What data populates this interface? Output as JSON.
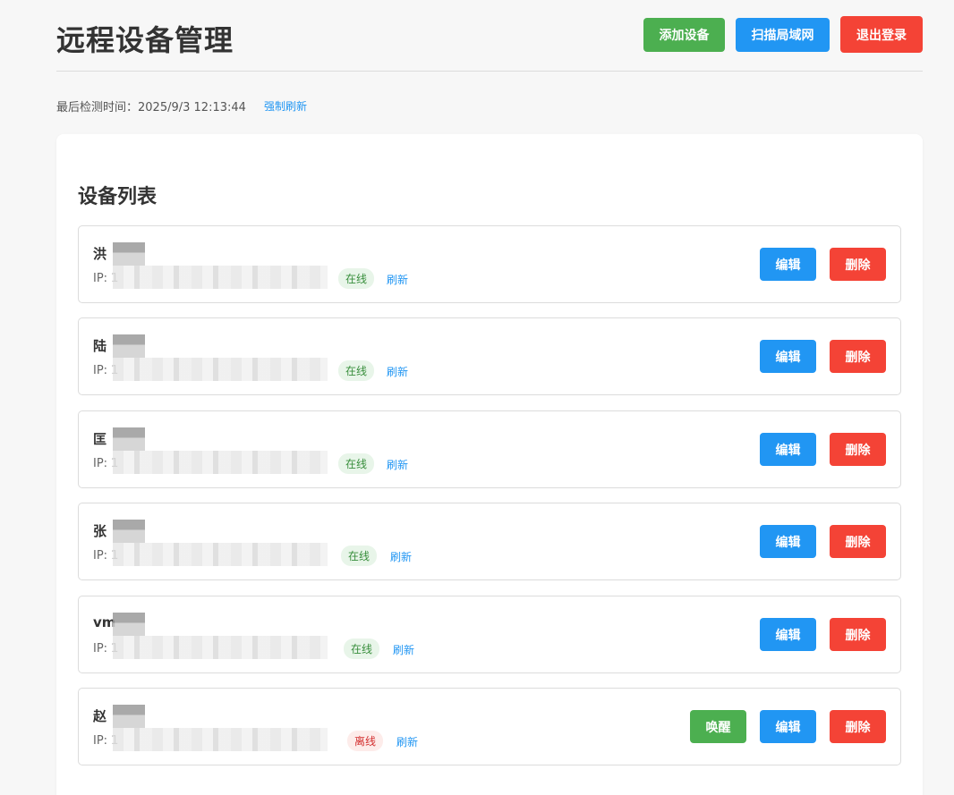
{
  "header": {
    "title": "远程设备管理",
    "add_label": "添加设备",
    "scan_label": "扫描局域网",
    "logout_label": "退出登录"
  },
  "status": {
    "last_check_label": "最后检测时间：",
    "last_check_time": "2025/9/3 12:13:44",
    "force_refresh_label": "强制刷新"
  },
  "device_list": {
    "title": "设备列表",
    "ip_label": "IP: 1",
    "refresh_label": "刷新",
    "edit_label": "编辑",
    "delete_label": "删除",
    "wake_label": "唤醒",
    "devices": [
      {
        "name": "洪",
        "status": "在线"
      },
      {
        "name": "陆",
        "status": "在线"
      },
      {
        "name": "匡",
        "status": "在线"
      },
      {
        "name": "张",
        "status": "在线"
      },
      {
        "name": "vm",
        "status": "在线"
      },
      {
        "name": "赵",
        "status": "离线"
      }
    ]
  },
  "colors": {
    "green": "#4caf50",
    "blue": "#2196f3",
    "red": "#f44336",
    "online_badge_bg": "#e8f5e9",
    "offline_badge_bg": "#fdecea"
  }
}
